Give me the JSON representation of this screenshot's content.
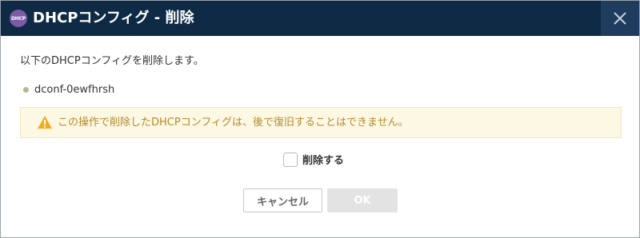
{
  "dialog": {
    "app_icon_text": "DHCP",
    "title": "DHCPコンフィグ - 削除",
    "close_icon": "close-icon"
  },
  "body": {
    "message": "以下のDHCPコンフィグを削除します。",
    "items": [
      "dconf-0ewfhrsh"
    ],
    "warning": {
      "icon": "warning-icon",
      "text": "この操作で削除したDHCPコンフィグは、後で復旧することはできません。"
    },
    "confirm": {
      "label": "削除する",
      "checked": false
    }
  },
  "buttons": {
    "cancel_label": "キャンセル",
    "ok_label": "OK",
    "ok_disabled": true
  },
  "colors": {
    "titlebar": "#0f2a45",
    "close_bg": "#1d3c5e",
    "warning_bg": "#fcf8e4",
    "warning_text": "#b58b2d",
    "warning_icon": "#f0ad1c"
  }
}
